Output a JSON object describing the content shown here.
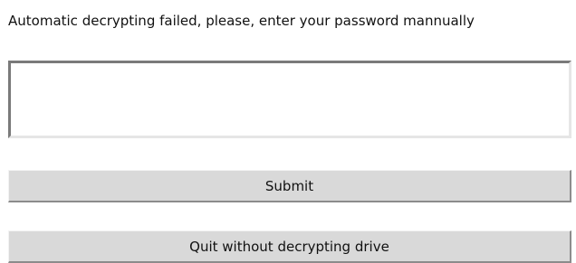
{
  "dialog": {
    "prompt": "Automatic decrypting failed, please, enter your password mannually",
    "password_value": "",
    "submit_label": "Submit",
    "quit_label": "Quit without decrypting drive"
  },
  "colors": {
    "background": "#ffffff",
    "button_face": "#d9d9d9",
    "field_shadow": "#7a7a7a"
  }
}
